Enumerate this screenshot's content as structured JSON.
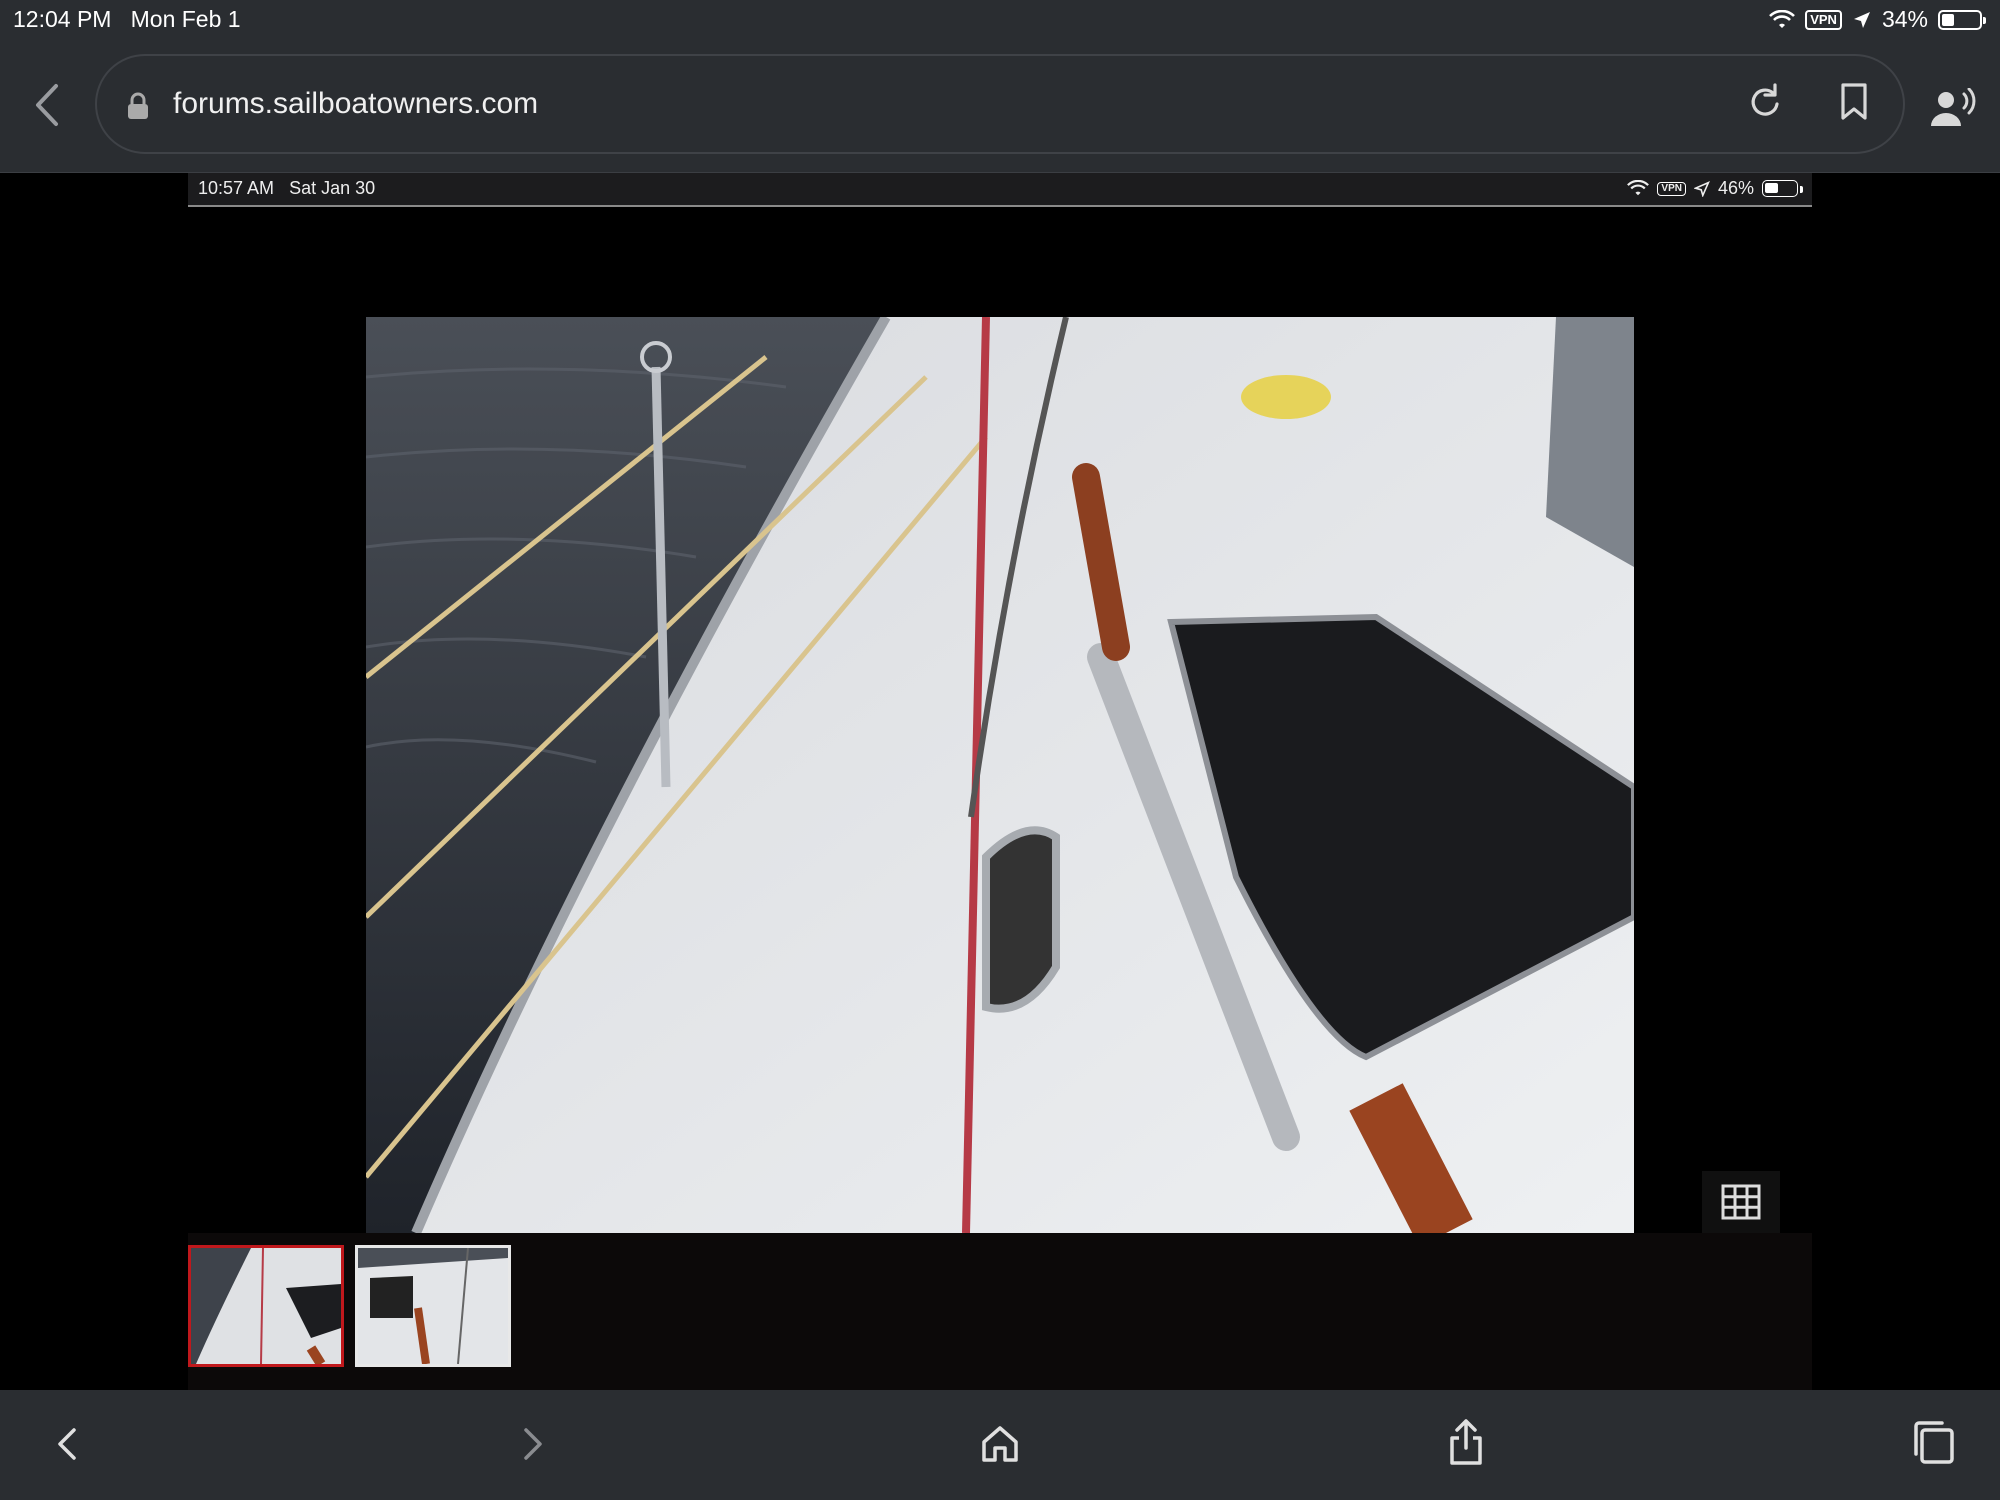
{
  "device_status": {
    "time": "12:04 PM",
    "date": "Mon Feb 1",
    "vpn": "VPN",
    "battery": "34%",
    "battery_level": 0.34
  },
  "browser": {
    "url": "forums.sailboatowners.com",
    "icons": [
      "chevron-left-icon",
      "lock-icon",
      "reload-icon",
      "bookmark-icon",
      "reader-voice-icon"
    ]
  },
  "embedded_screenshot_status": {
    "time": "10:57 AM",
    "date": "Sat Jan 30",
    "vpn": "VPN",
    "battery": "46%",
    "battery_level": 0.46
  },
  "gallery": {
    "selected_index": 0,
    "thumbnail_count": 2,
    "grid_button": "grid-icon"
  },
  "bottom_toolbar": {
    "icons": [
      "back-icon",
      "forward-icon",
      "home-icon",
      "share-icon",
      "tabs-icon"
    ]
  },
  "colors": {
    "chrome": "#2a2d31",
    "selected_thumb_border": "#c0181c",
    "thumb_border": "#e8e8e8"
  }
}
